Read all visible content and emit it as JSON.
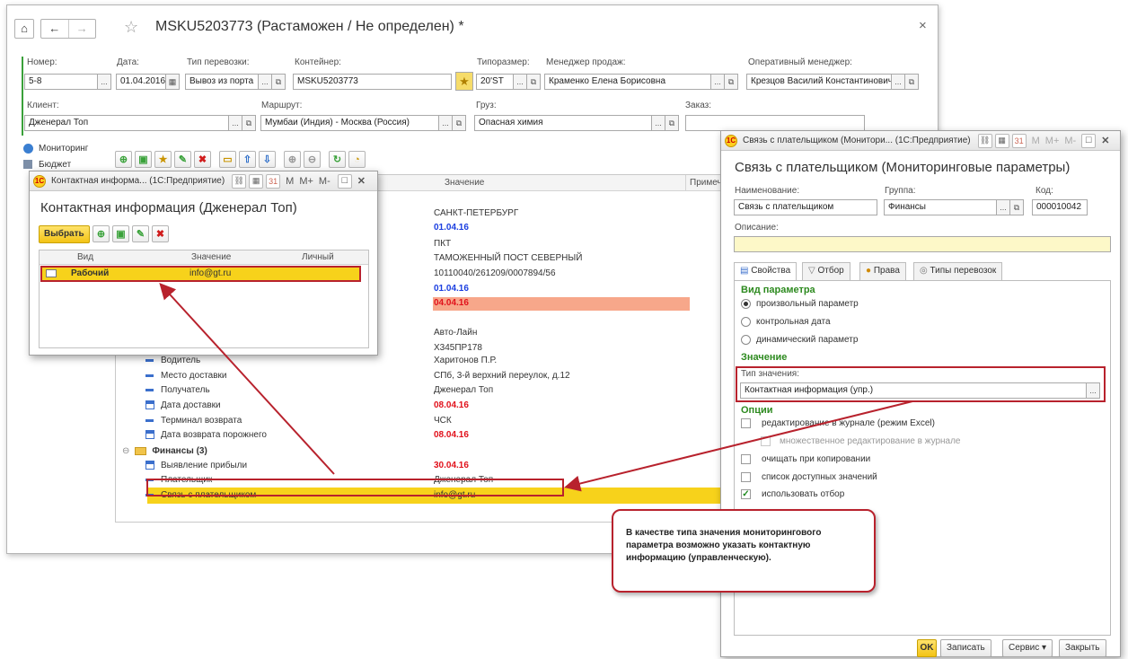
{
  "main": {
    "title": "MSKU5203773 (Растаможен / Не определен) *",
    "close": "×",
    "fields": {
      "number_label": "Номер:",
      "number_value": "5-8",
      "date_label": "Дата:",
      "date_value": "01.04.2016",
      "transport_label": "Тип перевозки:",
      "transport_value": "Вывоз из порта",
      "container_label": "Контейнер:",
      "container_value": "MSKU5203773",
      "size_label": "Типоразмер:",
      "size_value": "20'ST",
      "sales_label": "Менеджер продаж:",
      "sales_value": "Краменко Елена Борисовна",
      "oper_label": "Оперативный менеджер:",
      "oper_value": "Крезцов Василий Константинович",
      "client_label": "Клиент:",
      "client_value": "Дженерал Топ",
      "route_label": "Маршрут:",
      "route_value": "Мумбаи (Индия) - Москва (Россия)",
      "cargo_label": "Груз:",
      "cargo_value": "Опасная химия",
      "order_label": "Заказ:",
      "order_value": ""
    },
    "side": [
      "Мониторинг",
      "Бюджет"
    ],
    "grid_headers": [
      "Значение",
      "Примеча"
    ],
    "values_top": [
      "САНКТ-ПЕТЕРБУРГ",
      "01.04.16",
      "ПКТ",
      "ТАМОЖЕННЫЙ ПОСТ СЕВЕРНЫЙ",
      "10110040/261209/0007894/56",
      "01.04.16",
      "04.04.16"
    ],
    "tree_rows": [
      {
        "name": "Водитель",
        "value": "Харитонов П.Р.",
        "kind": "dash",
        "style": "normal"
      },
      {
        "name": "Место доставки",
        "value": "СПб, 3-й верхний переулок, д.12",
        "kind": "dash",
        "style": "normal"
      },
      {
        "name": "Получатель",
        "value": "Дженерал Топ",
        "kind": "dash",
        "style": "normal"
      },
      {
        "name": "Дата доставки",
        "value": "08.04.16",
        "kind": "cal",
        "style": "red"
      },
      {
        "name": "Терминал возврата",
        "value": "ЧСК",
        "kind": "dash",
        "style": "normal"
      },
      {
        "name": "Дата возврата порожнего",
        "value": "08.04.16",
        "kind": "cal",
        "style": "red"
      },
      {
        "name": "Финансы (3)",
        "value": "",
        "kind": "folder",
        "style": "bold"
      },
      {
        "name": "Выявление прибыли",
        "value": "30.04.16",
        "kind": "cal",
        "style": "red"
      },
      {
        "name": "Плательщик",
        "value": "Дженерал Топ",
        "kind": "dash",
        "style": "normal"
      },
      {
        "name": "Связь с плательщиком",
        "value": "info@gt.ru",
        "kind": "dash",
        "style": "selected"
      }
    ],
    "values_mid": [
      "Авто-Лайн",
      "Х345ПР178"
    ]
  },
  "contact": {
    "titlebar": "Контактная информа... (1С:Предприятие)",
    "heading": "Контактная информация (Дженерал Топ)",
    "select_button": "Выбрать",
    "columns": [
      "Вид",
      "Значение",
      "Личный"
    ],
    "row": {
      "kind": "Рабочий",
      "value": "info@gt.ru"
    }
  },
  "link": {
    "titlebar": "Связь с плательщиком (Монитори... (1С:Предприятие)",
    "heading": "Связь с плательщиком (Мониторинговые параметры)",
    "name_label": "Наименование:",
    "name_value": "Связь с плательщиком",
    "group_label": "Группа:",
    "group_value": "Финансы",
    "code_label": "Код:",
    "code_value": "000010042",
    "desc_label": "Описание:",
    "tabs": [
      "Свойства",
      "Отбор",
      "Права",
      "Типы перевозок"
    ],
    "param_section": "Вид параметра",
    "radios": [
      "произвольный параметр",
      "контрольная дата",
      "динамический параметр"
    ],
    "value_section": "Значение",
    "type_label": "Тип значения:",
    "type_value": "Контактная информация (упр.)",
    "options_section": "Опции",
    "options": [
      "редактирование в журнале (режим Excel)",
      "множественное редактирование в журнале",
      "очищать при копировании",
      "список доступных значений",
      "использовать отбор"
    ],
    "buttons": {
      "ok": "OK",
      "save": "Записать",
      "service": "Сервис",
      "close": "Закрыть"
    }
  },
  "callout": {
    "text": "В качестве типа значения мониторингового параметра возможно указать контактную информацию (управленческую)."
  },
  "colors": {
    "accent_red": "#b8222d",
    "selected_row": "#f7d21b",
    "highlight_row": "#f7a78a"
  }
}
